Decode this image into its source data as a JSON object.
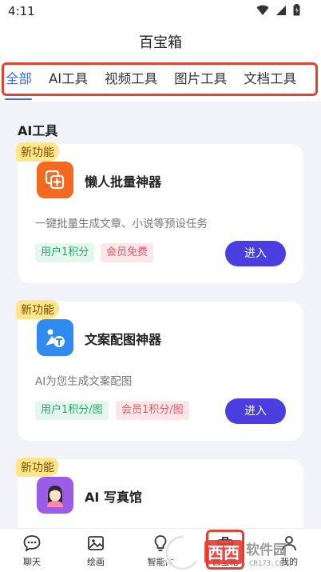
{
  "status": {
    "time": "4:11"
  },
  "header": {
    "title": "百宝箱"
  },
  "tabs": [
    {
      "label": "全部"
    },
    {
      "label": "AI工具"
    },
    {
      "label": "视频工具"
    },
    {
      "label": "图片工具"
    },
    {
      "label": "文档工具"
    }
  ],
  "section": {
    "title": "AI工具"
  },
  "cards": [
    {
      "badge": "新功能",
      "title": "懒人批量神器",
      "desc": "一键批量生成文章、小说等预设任务",
      "tag1": "用户1积分",
      "tag2": "会员免费",
      "button": "进入",
      "icon": "batch-add-icon",
      "icon_color": "#f26a1f"
    },
    {
      "badge": "新功能",
      "title": "文案配图神器",
      "desc": "AI为您生成文案配图",
      "tag1": "用户1积分/图",
      "tag2": "会员1积分/图",
      "button": "进入",
      "icon": "image-text-icon",
      "icon_color": "#2f8bef"
    },
    {
      "badge": "新功能",
      "title": "AI 写真馆",
      "icon": "portrait-avatar-icon",
      "icon_color": "#9b5de5"
    }
  ],
  "nav": [
    {
      "label": "聊天",
      "icon": "chat-icon"
    },
    {
      "label": "绘画",
      "icon": "image-icon"
    },
    {
      "label": "智能体",
      "icon": "bulb-icon"
    },
    {
      "label": "百宝箱",
      "icon": "toolbox-icon"
    },
    {
      "label": "我的",
      "icon": "user-icon"
    }
  ],
  "watermark": {
    "text": "西西软件园",
    "sub": "CR173.COM"
  },
  "colors": {
    "accent": "#3d6df2",
    "button": "#4a3ee0",
    "highlight_border": "#e0432f"
  }
}
